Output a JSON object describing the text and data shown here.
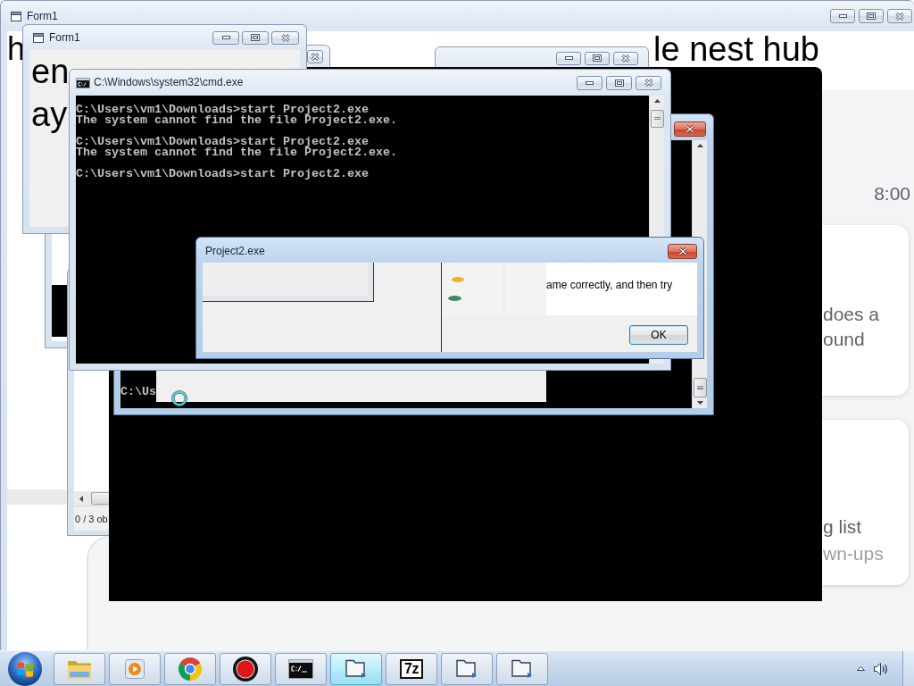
{
  "background_window": {
    "title": "Form1",
    "active": false,
    "heading": {
      "start": "h",
      "end": "le nest hub"
    }
  },
  "window_behind_left": {
    "active": false
  },
  "window_behind_top": {
    "active": false
  },
  "web_page": {
    "time": "8:00",
    "cards": [
      {
        "title_lines": [
          "does a",
          "ound"
        ]
      },
      {
        "title_lines": [
          "g list"
        ],
        "subtitle": "wn-ups"
      }
    ]
  },
  "explorer_window": {
    "status": "0 / 3 ob"
  },
  "form_window": {
    "title": "Form1",
    "active": false,
    "lines": [
      "en",
      "ay"
    ]
  },
  "back_console": {
    "active": true,
    "prompt": "C:\\Us"
  },
  "console_window": {
    "title": "C:\\Windows\\system32\\cmd.exe",
    "active": false,
    "blocks": [
      [
        "C:\\Users\\vm1\\Downloads>start Project2.exe",
        "The system cannot find the file Project2.exe."
      ],
      [
        "C:\\Users\\vm1\\Downloads>start Project2.exe",
        "The system cannot find the file Project2.exe."
      ],
      [
        "C:\\Users\\vm1\\Downloads>start Project2.exe"
      ]
    ]
  },
  "dialog": {
    "title": "Project2.exe",
    "active": true,
    "message": "ame correctly, and then try",
    "button": "OK"
  },
  "taskbar": {
    "items": [
      {
        "kind": "explorer",
        "selected": false
      },
      {
        "kind": "media",
        "selected": false
      },
      {
        "kind": "browser",
        "selected": false
      },
      {
        "kind": "recorder",
        "selected": false
      },
      {
        "kind": "console",
        "selected": false
      },
      {
        "kind": "folder",
        "selected": true
      },
      {
        "kind": "archiver",
        "label": "7z",
        "selected": false
      },
      {
        "kind": "folder",
        "selected": false
      },
      {
        "kind": "folder",
        "selected": false
      }
    ]
  }
}
